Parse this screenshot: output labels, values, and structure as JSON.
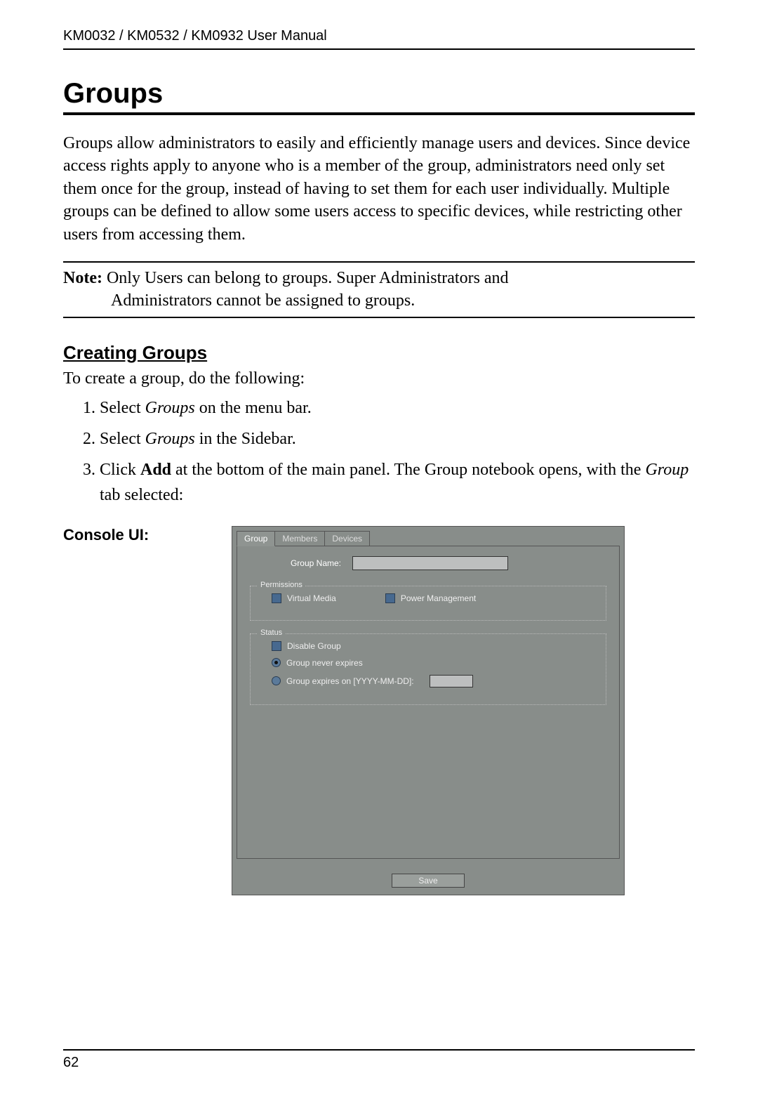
{
  "header": "KM0032 / KM0532 / KM0932 User Manual",
  "title": "Groups",
  "intro": "Groups allow administrators to easily and efficiently manage users and devices. Since device access rights apply to anyone who is a member of the group, administrators need only set them once for the group, instead of having to set them for each user individually. Multiple groups can be defined to allow some users access to specific devices, while restricting other users from accessing them.",
  "note": {
    "label": "Note:",
    "line1": "Only Users can belong to groups. Super Administrators and",
    "line2": "Administrators cannot be assigned to groups."
  },
  "subsection": "Creating Groups",
  "subsection_intro": "To create a group, do the following:",
  "steps": {
    "s1a": "Select ",
    "s1b": "Groups",
    "s1c": " on the menu bar.",
    "s2a": "Select ",
    "s2b": "Groups",
    "s2c": " in the Sidebar.",
    "s3a": "Click ",
    "s3b": "Add",
    "s3c": " at the bottom of the main panel. The Group notebook opens, with the ",
    "s3d": "Group",
    "s3e": " tab selected:"
  },
  "console_label": "Console UI:",
  "ui": {
    "tabs": {
      "group": "Group",
      "members": "Members",
      "devices": "Devices"
    },
    "group_name_label": "Group Name:",
    "permissions_title": "Permissions",
    "virtual_media": "Virtual Media",
    "power_mgmt": "Power Management",
    "status_title": "Status",
    "disable_group": "Disable Group",
    "never_expires": "Group never expires",
    "expires_on": "Group expires on [YYYY-MM-DD]:",
    "save": "Save"
  },
  "page_number": "62"
}
